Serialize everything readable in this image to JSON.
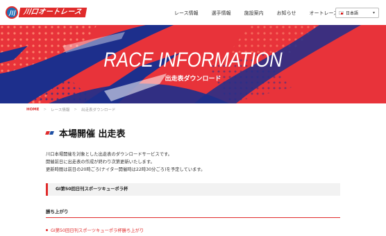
{
  "header": {
    "logo_badge": "川",
    "logo_text": "川口オートレース",
    "nav": [
      "レース情報",
      "選手情報",
      "施設案内",
      "お知らせ",
      "オートレースガイド"
    ],
    "language": {
      "selected": "日本語"
    }
  },
  "hero": {
    "title": "RACE INFORMATION",
    "subtitle": "出走表ダウンロード",
    "colors": {
      "background": "#e8333a",
      "stripe": "#1d2f8c",
      "accent": "#ff8c73"
    }
  },
  "breadcrumb": [
    "HOME",
    "レース情報",
    "出走表ダウンロード"
  ],
  "main": {
    "title": "本場開催 出走表",
    "description": [
      "川口本場開催を対象とした出走表のダウンロードサービスです。",
      "開催前日に出走表の作成が終わり次第更新いたします。",
      "更新時間は前日の20時ごろ(ナイター開催時は22時30分ごろ)を予定しています。"
    ],
    "event_title": "GI第50回日刊スポーツキューポラ杯",
    "section_heading": "勝ち上がり",
    "links": [
      "GI第50回日刊スポーツキューポラ杯勝ち上がり"
    ]
  }
}
